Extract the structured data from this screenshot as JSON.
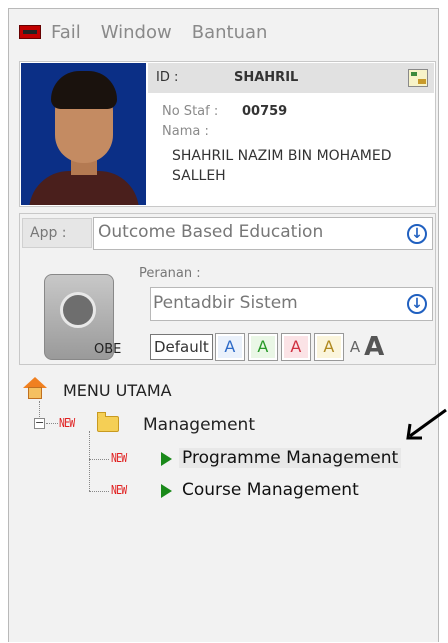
{
  "menubar": {
    "items": [
      "Fail",
      "Window",
      "Bantuan"
    ]
  },
  "profile": {
    "id_label": "ID :",
    "id_value": "SHAHRIL",
    "staf_label": "No Staf :",
    "staf_value": "00759",
    "nama_label": "Nama :",
    "nama_value": "SHAHRIL NAZIM BIN MOHAMED SALLEH"
  },
  "app": {
    "label": "App :",
    "selected": "Outcome Based Education",
    "obe_label": "OBE",
    "peranan_label": "Peranan :",
    "peranan_selected": "Pentadbir Sistem",
    "default_label": "Default",
    "swatch_letters": [
      "A",
      "A",
      "A",
      "A"
    ],
    "font_small": "A",
    "font_large": "A"
  },
  "tree": {
    "root": "MENU UTAMA",
    "new_tag": "NEW",
    "folder": "Management",
    "items": [
      "Programme Management",
      "Course Management"
    ]
  },
  "colors": {
    "accent_blue": "#2060c0",
    "new_red": "#e02020",
    "play_green": "#1a8a1a"
  }
}
